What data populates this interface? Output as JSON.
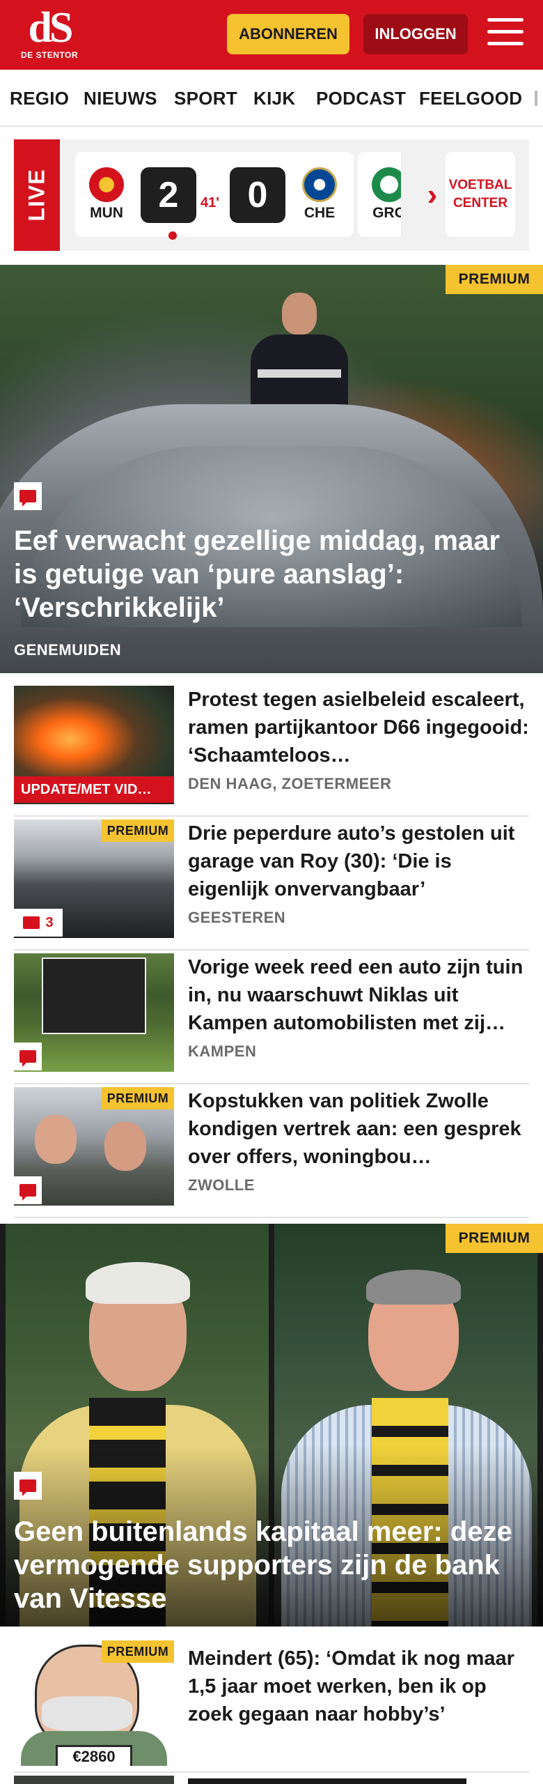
{
  "header": {
    "logo_mark": "dS",
    "logo_text": "DE STENTOR",
    "subscribe_label": "ABONNEREN",
    "login_label": "INLOGGEN",
    "brand_color": "#d4121e"
  },
  "nav": {
    "items": [
      "REGIO",
      "NIEUWS",
      "SPORT",
      "KIJK",
      "PODCAST",
      "FEELGOOD"
    ]
  },
  "live": {
    "label": "LIVE",
    "match": {
      "home_code": "MUN",
      "home_score": "2",
      "minute": "41'",
      "away_score": "0",
      "away_code": "CHE"
    },
    "next_match_code": "GRO",
    "voetbal_center_label": "VOETBAL CENTER"
  },
  "premium_label": "PREMIUM",
  "hero1": {
    "title": "Eef verwacht gezellige middag, maar is getuige van ‘pure aanslag’: ‘Verschrikkelijk’",
    "location": "GENEMUIDEN"
  },
  "articles": [
    {
      "title": "Protest tegen asielbeleid escaleert, ramen partijkantoor D66 ingegooid: ‘Schaamteloos…",
      "location": "DEN HAAG, ZOETERMEER",
      "tag": "UPDATE/MET VID…"
    },
    {
      "title": "Drie peperdure auto’s gestolen uit garage van Roy (30): ‘Die is eigenlijk onvervangbaar’",
      "location": "GEESTEREN",
      "comments": "3"
    },
    {
      "title": "Vorige week reed een auto zijn tuin in, nu waarschuwt Niklas uit Kampen automobilisten met zij…",
      "location": "KAMPEN"
    },
    {
      "title": "Kopstukken van politiek Zwolle kondigen vertrek aan: een gesprek over offers, woningbou…",
      "location": "ZWOLLE"
    }
  ],
  "hero2": {
    "title": "Geen buitenlands kapitaal meer: deze vermogende supporters zijn de bank van Vitesse"
  },
  "article5": {
    "title": "Meindert (65): ‘Omdat ik nog maar 1,5 jaar moet werken, ben ik op zoek gegaan naar hobby’s’",
    "price_tag": "€2860"
  }
}
